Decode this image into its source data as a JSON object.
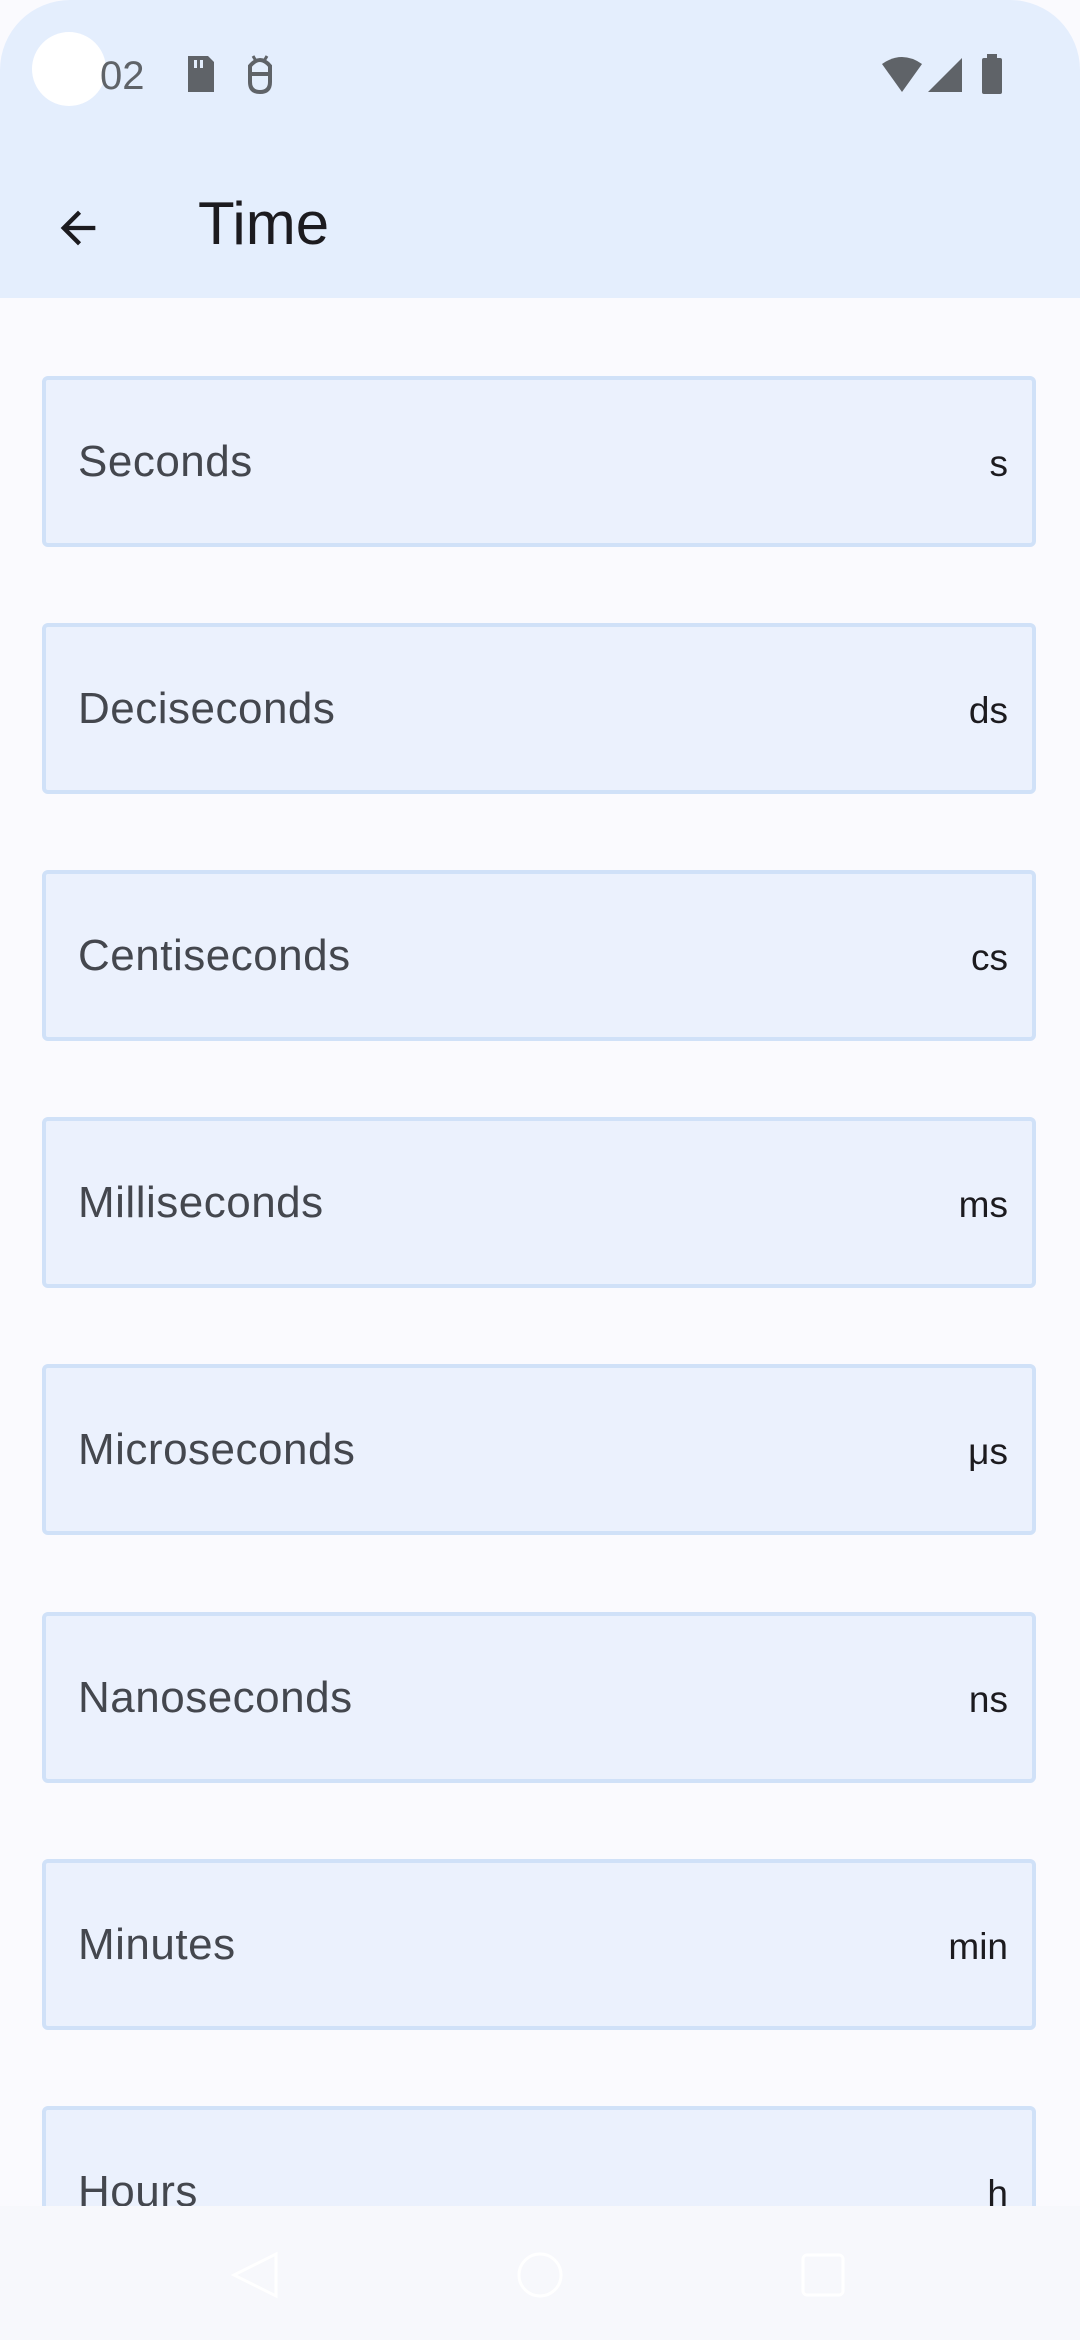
{
  "status_bar": {
    "time": "02",
    "icons": [
      "sd-card-icon",
      "android-debug-icon",
      "wifi-icon",
      "cell-signal-icon",
      "battery-icon"
    ]
  },
  "app_bar": {
    "title": "Time",
    "back_icon": "arrow-back-icon"
  },
  "units": [
    {
      "name": "Seconds",
      "symbol": "s"
    },
    {
      "name": "Deciseconds",
      "symbol": "ds"
    },
    {
      "name": "Centiseconds",
      "symbol": "cs"
    },
    {
      "name": "Milliseconds",
      "symbol": "ms"
    },
    {
      "name": "Microseconds",
      "symbol": "μs"
    },
    {
      "name": "Nanoseconds",
      "symbol": "ns"
    },
    {
      "name": "Minutes",
      "symbol": "min"
    },
    {
      "name": "Hours",
      "symbol": "h"
    }
  ],
  "nav_bar": {
    "buttons": [
      "back-triangle-icon",
      "home-circle-icon",
      "recents-square-icon"
    ]
  },
  "colors": {
    "header_bg": "#e4eefd",
    "card_bg": "#ebf1fd",
    "card_border": "#d0e1f8",
    "page_bg": "#fafafe"
  }
}
